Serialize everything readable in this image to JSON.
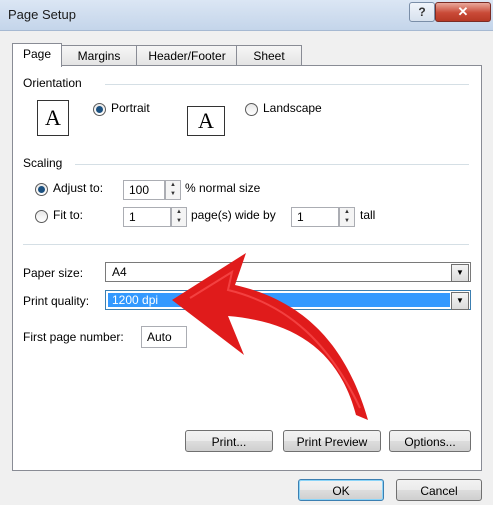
{
  "window": {
    "title": "Page Setup",
    "help_label": "?",
    "close_label": "✕"
  },
  "tabs": [
    {
      "label": "Page"
    },
    {
      "label": "Margins"
    },
    {
      "label": "Header/Footer"
    },
    {
      "label": "Sheet"
    }
  ],
  "orientation": {
    "heading": "Orientation",
    "portrait_label": "Portrait",
    "landscape_label": "Landscape",
    "icon_glyph": "A",
    "selected": "portrait"
  },
  "scaling": {
    "heading": "Scaling",
    "adjust_to_label": "Adjust to:",
    "adjust_value": "100",
    "adjust_suffix": "% normal size",
    "fit_to_label": "Fit to:",
    "fit_wide_value": "1",
    "fit_wide_suffix": "page(s) wide by",
    "fit_tall_value": "1",
    "fit_tall_suffix": "tall",
    "selected": "adjust"
  },
  "paper": {
    "paper_size_label": "Paper size:",
    "paper_size_value": "A4",
    "print_quality_label": "Print quality:",
    "print_quality_value": "1200 dpi",
    "first_page_label": "First page number:",
    "first_page_value": "Auto"
  },
  "actions": {
    "print_label": "Print...",
    "preview_label": "Print Preview",
    "options_label": "Options..."
  },
  "footer": {
    "ok_label": "OK",
    "cancel_label": "Cancel"
  },
  "annotation": {
    "arrow_color": "#e01b1b"
  },
  "icons": [
    "help-icon",
    "close-icon",
    "portrait-page-icon",
    "landscape-page-icon",
    "spin-up-icon",
    "spin-down-icon",
    "dropdown-arrow-icon"
  ]
}
